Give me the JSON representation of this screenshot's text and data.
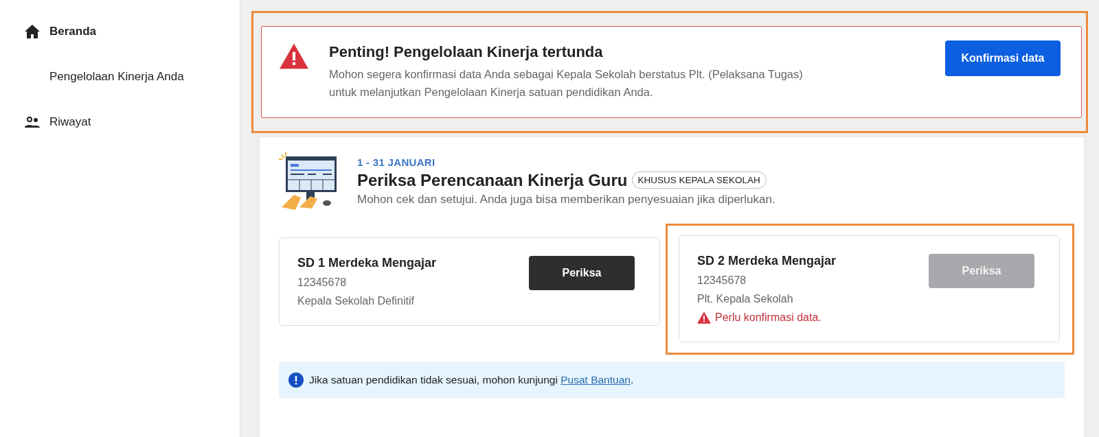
{
  "sidebar": {
    "items": [
      {
        "label": "Beranda",
        "kind": "home",
        "selected": true
      },
      {
        "label": "Pengelolaan Kinerja Anda",
        "kind": "sub",
        "selected": false
      },
      {
        "label": "Riwayat",
        "kind": "people",
        "selected": false
      }
    ]
  },
  "alert": {
    "highlighted": true,
    "title": "Penting! Pengelolaan Kinerja tertunda",
    "message": "Mohon segera konfirmasi data Anda sebagai Kepala Sekolah berstatus Plt. (Pelaksana Tugas) untuk melanjutkan Pengelolaan Kinerja satuan pendidikan Anda.",
    "button": "Konfirmasi data"
  },
  "task": {
    "date": "1 - 31 JANUARI",
    "title": "Periksa Perencanaan Kinerja Guru",
    "badge": "KHUSUS KEPALA SEKOLAH",
    "description": "Mohon cek dan setujui. Anda juga bisa memberikan penyesuaian jika diperlukan.",
    "schools": [
      {
        "name": "SD 1 Merdeka Mengajar",
        "id": "12345678",
        "role": "Kepala Sekolah Definitif",
        "button": "Periksa",
        "disabled": false,
        "highlighted": false
      },
      {
        "name": "SD 2 Merdeka Mengajar",
        "id": "12345678",
        "role": "Plt. Kepala Sekolah",
        "button": "Periksa",
        "disabled": true,
        "highlighted": true,
        "warning": "Perlu konfirmasi data."
      }
    ],
    "info": {
      "text": "Jika satuan pendidikan tidak sesuai, mohon kunjungi ",
      "link": "Pusat Bantuan",
      "after": "."
    }
  }
}
